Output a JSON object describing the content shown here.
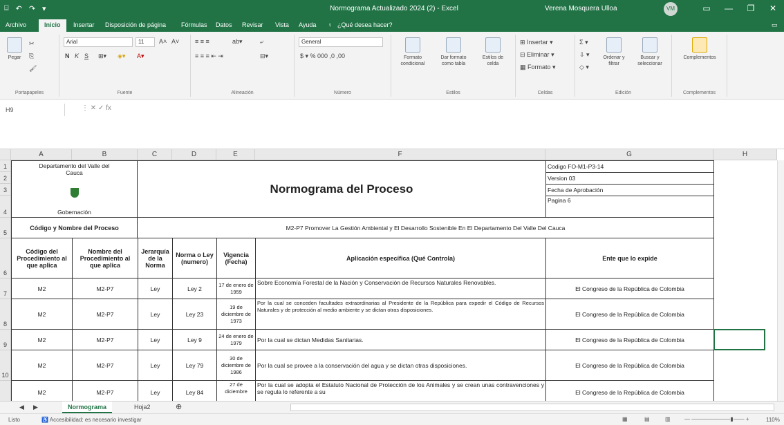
{
  "window": {
    "title": "Normograma Actualizado 2024 (2) - Excel",
    "user": "Verena Mosquera Ulloa",
    "avatar_initials": "VM",
    "quick_access": [
      "⌸",
      "↶",
      "↷",
      "▾"
    ],
    "controls": [
      "▭",
      "—",
      "❐",
      "✕"
    ]
  },
  "menu": {
    "items": [
      "Archivo",
      "Inicio",
      "Insertar",
      "Disposición de página",
      "Fórmulas",
      "Datos",
      "Revisar",
      "Vista",
      "Ayuda"
    ],
    "search": "¿Qué desea hacer?",
    "active": "Inicio"
  },
  "ribbon": {
    "paste": "Pegar",
    "clipboard_group": "Portapapeles",
    "font_name": "Arial",
    "font_size": "11",
    "font_group": "Fuente",
    "bold": "N",
    "italic": "K",
    "underline": "S",
    "align_group": "Alineación",
    "number_format": "General",
    "number_group": "Número",
    "cond_format": "Formato condicional",
    "table_format": "Dar formato como tabla",
    "cell_styles": "Estilos de celda",
    "styles_group": "Estilos",
    "insert": "Insertar",
    "delete": "Eliminar",
    "format": "Formato",
    "cells_group": "Celdas",
    "sort": "Ordenar y filtrar",
    "find": "Buscar y seleccionar",
    "edit_group": "Edición",
    "addins": "Complementos",
    "addins_group": "Complementos"
  },
  "formula": {
    "namebox": "H9",
    "fx": "fx",
    "content": ""
  },
  "columns": [
    "A",
    "B",
    "C",
    "D",
    "E",
    "F",
    "G",
    "H"
  ],
  "rows": [
    "1",
    "2",
    "3",
    "4",
    "5",
    "6",
    "7",
    "8",
    "9",
    "10"
  ],
  "header": {
    "dept_line1": "Departamento del Valle del Cauca",
    "dept_line2": "Gobernación",
    "title": "Normograma del Proceso",
    "code": "Codigo FO-M1-P3-14",
    "version": "Version 03",
    "approval": "Fecha de Aprobación",
    "page": "Pagina 6",
    "process_label": "Código y Nombre del Proceso",
    "process_name": "M2-P7 Promover La Gestión Ambiental y El Desarrollo Sostenible En El Departamento Del Valle Del Cauca"
  },
  "table": {
    "headers": [
      "Código del Procedimiento al que aplica",
      "Nombre del Procedimiento al que aplica",
      "Jerarquía de la Norma",
      "Norma o Ley (numero)",
      "Vigencia (Fecha)",
      "Aplicación específica (Qué Controla)",
      "Ente que lo expide"
    ],
    "rows": [
      [
        "M2",
        "M2-P7",
        "Ley",
        "Ley 2",
        "17 de enero de 1959",
        "Sobre Economía Forestal de la Nación y Conservación de Recursos Naturales Renovables.",
        "El Congreso de la República de Colombia"
      ],
      [
        "M2",
        "M2-P7",
        "Ley",
        "Ley 23",
        "19 de diciembre de 1973",
        "Por la cual se conceden facultades extraordinarias al Presidente de la República para expedir el Código de Recursos Naturales y de protección al medio ambiente y se dictan otras disposiciones.",
        "El Congreso de la República de Colombia"
      ],
      [
        "M2",
        "M2-P7",
        "Ley",
        "Ley 9",
        "24 de enero de 1979",
        "Por la cual se dictan Medidas Sanitarias.",
        "El Congreso de la República de Colombia"
      ],
      [
        "M2",
        "M2-P7",
        "Ley",
        "Ley 79",
        "30 de diciembre de 1986",
        "Por la cual se provee a la conservación del agua y se dictan otras disposiciones.",
        "El Congreso de la República de Colombia"
      ],
      [
        "M2",
        "M2-P7",
        "Ley",
        "Ley 84",
        "27 de diciembre",
        "Por la cual se adopta el Estatuto Nacional de Protección de los Animales y se crean unas contravenciones y se regula lo referente a su",
        "El Congreso de la República de Colombia"
      ]
    ]
  },
  "sheets": [
    "Normograma",
    "Hoja2"
  ],
  "status": {
    "mode": "Listo",
    "accessibility": "Accesibilidad: es necesario investigar",
    "zoom": "110%"
  }
}
